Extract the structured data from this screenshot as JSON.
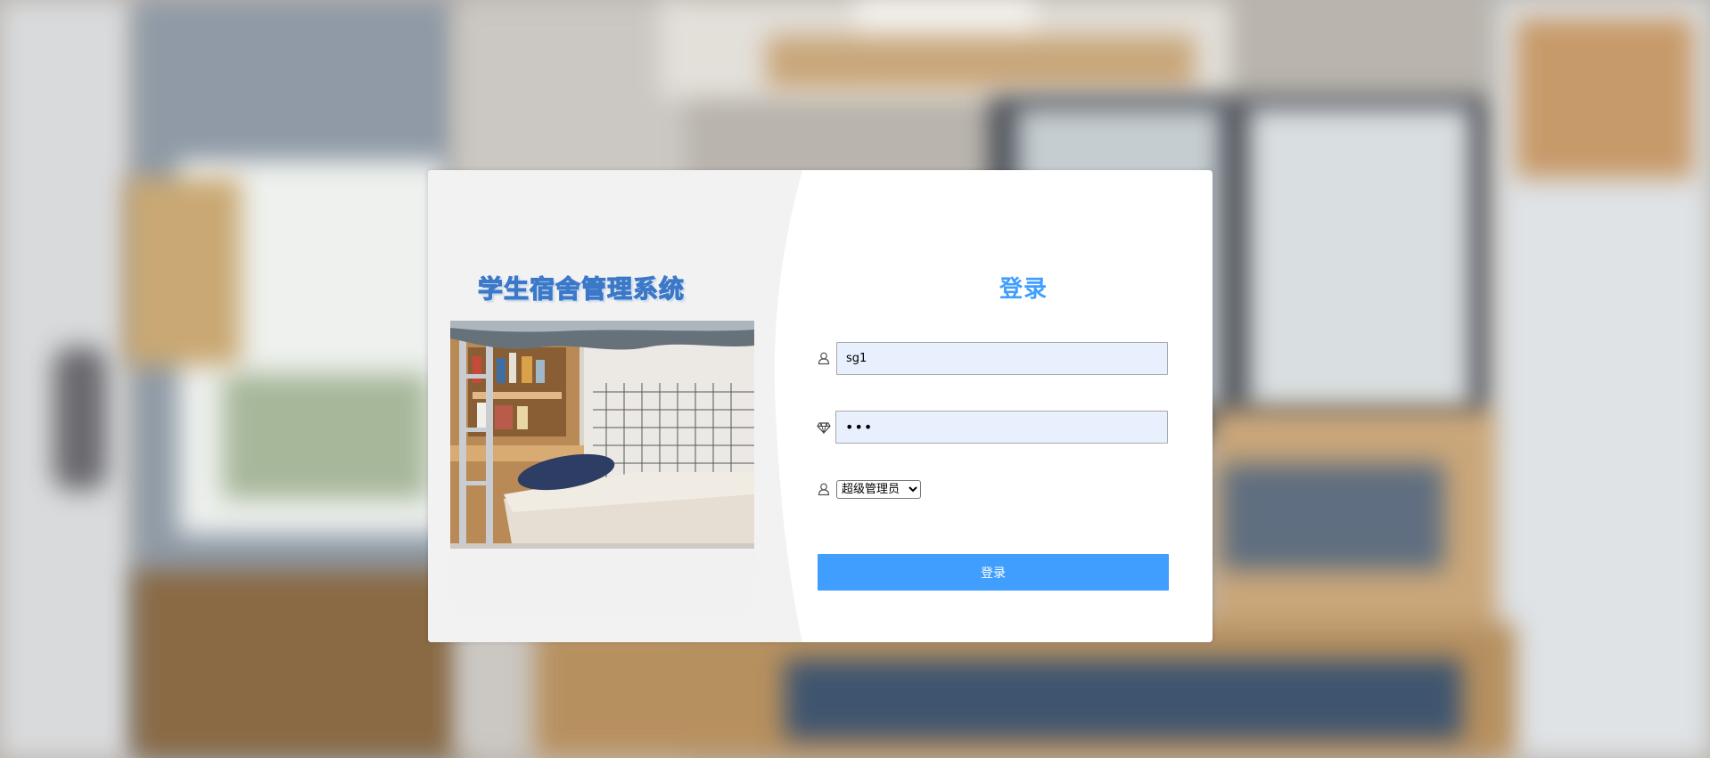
{
  "branding": {
    "system_title": "学生宿舍管理系统"
  },
  "login": {
    "title": "登录",
    "username": {
      "icon": "user-icon",
      "value": "sg1"
    },
    "password": {
      "icon": "diamond-icon",
      "value": "123"
    },
    "role": {
      "icon": "user-icon",
      "selected": "超级管理员",
      "options": [
        "超级管理员"
      ]
    },
    "submit_label": "登录"
  },
  "colors": {
    "accent": "#409eff",
    "field_bg": "#e8f0fe",
    "left_panel_bg": "#f2f2f2"
  }
}
